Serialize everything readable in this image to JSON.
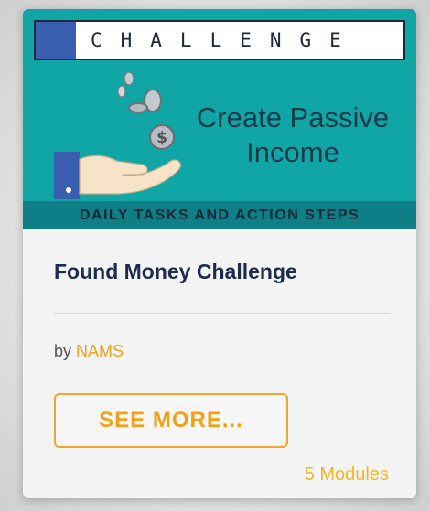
{
  "banner": {
    "label": "CHALLENGE",
    "headline_line1": "Create Passive",
    "headline_line2": "Income",
    "subtitle": "DAILY TASKS AND ACTION STEPS",
    "coin_symbol": "$"
  },
  "card": {
    "title": "Found Money Challenge",
    "by_prefix": "by",
    "author": "NAMS",
    "see_more_label": "SEE MORE...",
    "modules_count": "5 Modules"
  },
  "colors": {
    "banner_teal": "#11a6a6",
    "accent_orange": "#f4a017",
    "title_navy": "#1d2b4f",
    "challenge_square": "#3a5fb0"
  },
  "icons": {
    "coins": "coins-icon",
    "hand": "hand-icon"
  }
}
